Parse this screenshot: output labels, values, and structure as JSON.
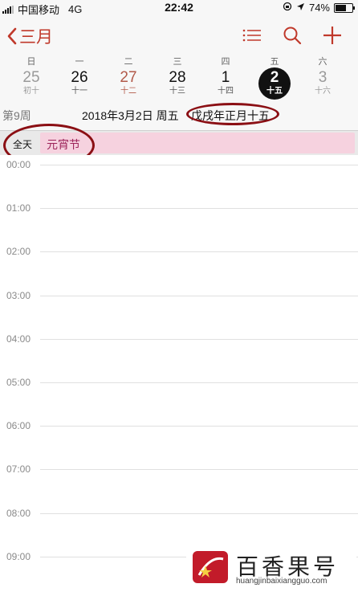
{
  "status_bar": {
    "carrier": "中国移动",
    "network": "4G",
    "time": "22:42",
    "battery": "74%",
    "battery_level": 0.74
  },
  "nav": {
    "back_label": "三月",
    "accent": "#c0392b"
  },
  "weekdays": [
    "日",
    "一",
    "二",
    "三",
    "四",
    "五",
    "六"
  ],
  "days": [
    {
      "num": "25",
      "lunar": "初十"
    },
    {
      "num": "26",
      "lunar": "十一"
    },
    {
      "num": "27",
      "lunar": "十二"
    },
    {
      "num": "28",
      "lunar": "十三"
    },
    {
      "num": "1",
      "lunar": "十四"
    },
    {
      "num": "2",
      "lunar": "十五"
    },
    {
      "num": "3",
      "lunar": "十六"
    }
  ],
  "info": {
    "week": "第9周",
    "date": "2018年3月2日 周五",
    "lunar": "戊戌年正月十五"
  },
  "all_day": {
    "label": "全天",
    "event": "元宵节",
    "event_color": "#f6d2df"
  },
  "hours": [
    "00:00",
    "01:00",
    "02:00",
    "03:00",
    "04:00",
    "05:00",
    "06:00",
    "07:00",
    "08:00",
    "09:00"
  ],
  "watermark": {
    "title": "百香果号",
    "url": "huangjinbaixiangguo.com"
  }
}
